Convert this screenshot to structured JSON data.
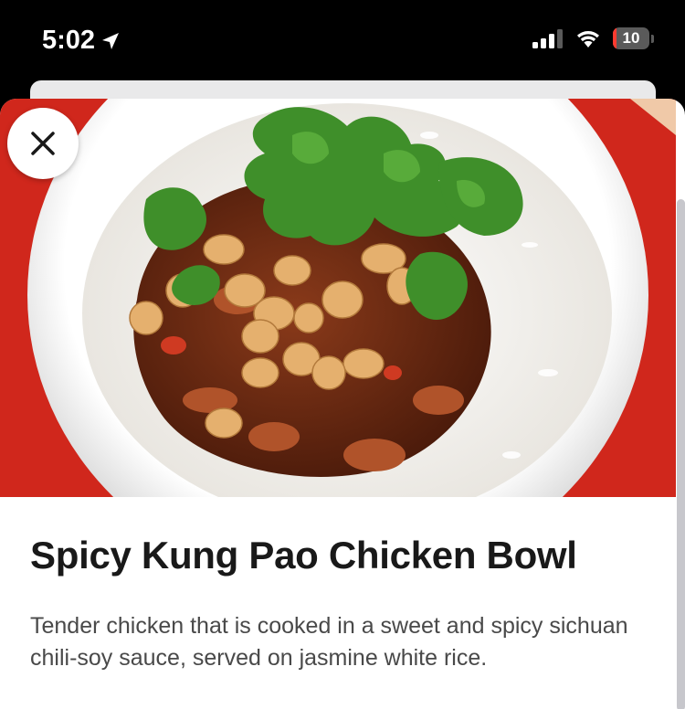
{
  "status_bar": {
    "time": "5:02",
    "battery_level": "10",
    "icons": [
      "location-arrow-icon",
      "cellular-signal-icon",
      "wifi-icon",
      "battery-icon"
    ]
  },
  "item": {
    "title": "Spicy Kung Pao Chicken Bowl",
    "description": "Tender chicken that is cooked in a sweet and spicy sichuan chili-soy sauce, served on jasmine white rice."
  },
  "colors": {
    "background": "#ffffff",
    "hero_backdrop": "#d92b1f",
    "title_text": "#191919",
    "description_text": "#494949",
    "battery_low": "#ff3b30"
  },
  "icons": {
    "close": "close-icon"
  }
}
